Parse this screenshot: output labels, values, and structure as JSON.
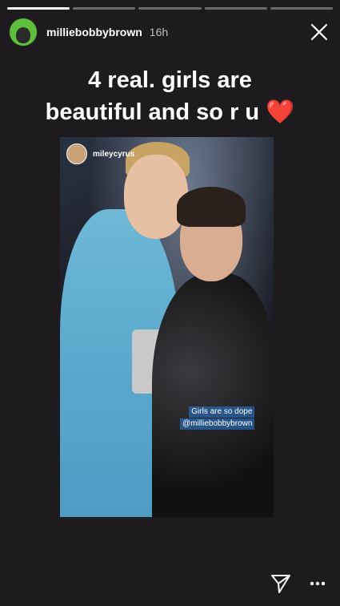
{
  "progress": {
    "segments": 5,
    "current": 1
  },
  "header": {
    "username": "milliebobbybrown",
    "time": "16h"
  },
  "caption": {
    "line1": "4 real. girls are",
    "line2": "beautiful and so r u",
    "emoji": "❤️"
  },
  "repost": {
    "username": "mileycyrus",
    "mention_line1": "Girls are so dope",
    "mention_line2": "@milliebobbybrown"
  },
  "colors": {
    "background": "#1d1b1e",
    "heart": "#e0302e"
  },
  "icons": {
    "close": "close-icon",
    "send": "send-icon",
    "more": "more-options-icon"
  }
}
